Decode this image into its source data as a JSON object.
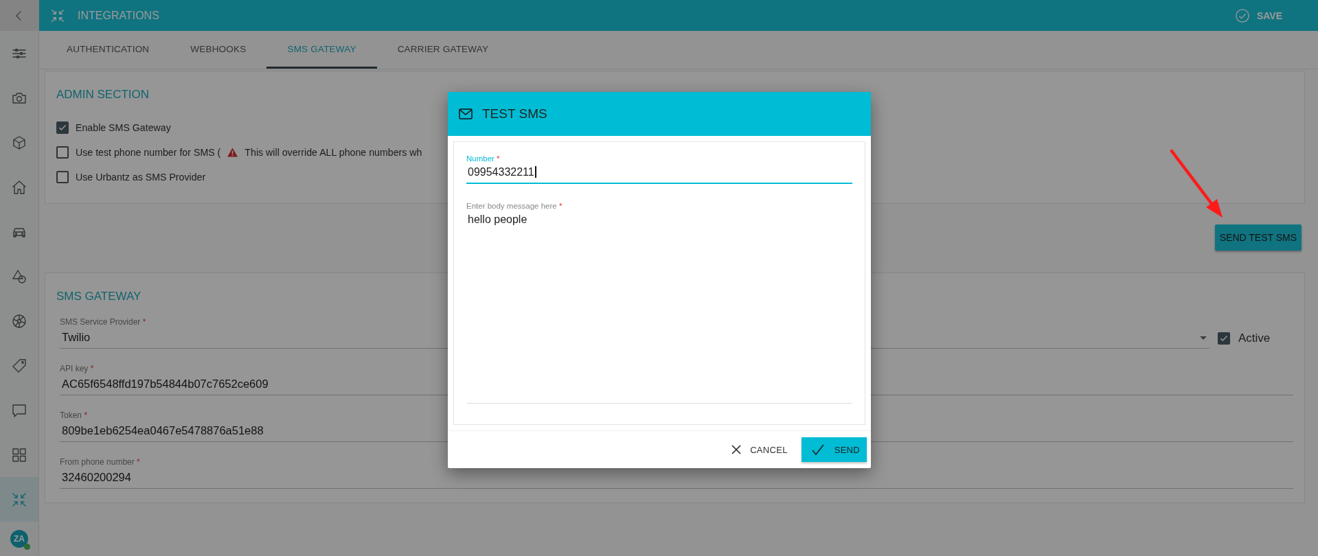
{
  "topbar": {
    "title": "INTEGRATIONS",
    "save": "SAVE"
  },
  "sidebar": {
    "items": [
      {
        "selected": false
      },
      {
        "selected": false
      },
      {
        "selected": false
      },
      {
        "selected": false
      },
      {
        "selected": false
      },
      {
        "selected": false
      },
      {
        "selected": false
      },
      {
        "selected": false
      },
      {
        "selected": false
      },
      {
        "selected": false
      },
      {
        "selected": true
      }
    ],
    "avatar": {
      "initials": "ZA",
      "online": true
    }
  },
  "tabs": [
    {
      "label": "AUTHENTICATION",
      "selected": false
    },
    {
      "label": "WEBHOOKS",
      "selected": false
    },
    {
      "label": "SMS GATEWAY",
      "selected": true
    },
    {
      "label": "CARRIER GATEWAY",
      "selected": false
    }
  ],
  "admin_section": {
    "title": "ADMIN SECTION",
    "checkboxes": [
      {
        "label": "Enable SMS Gateway",
        "checked": true
      },
      {
        "label": "Use test phone number for SMS (",
        "warning": "This will override ALL phone numbers wh",
        "checked": false
      },
      {
        "label": "Use Urbantz as SMS Provider",
        "checked": false
      }
    ]
  },
  "send_test_button": "SEND TEST SMS",
  "sms_gateway": {
    "title": "SMS GATEWAY",
    "fields": [
      {
        "kind": "select",
        "label": "SMS Service Provider",
        "required_mark": "*",
        "value": "Twilio",
        "active": {
          "label": "Active",
          "checked": true
        }
      },
      {
        "kind": "text",
        "label": "API key",
        "required_mark": "*",
        "value": "AC65f6548ffd197b54844b07c7652ce609"
      },
      {
        "kind": "text",
        "label": "Token",
        "required_mark": "*",
        "value": "809be1eb6254ea0467e5478876a51e88"
      },
      {
        "kind": "text",
        "label": "From phone number",
        "required_mark": "*",
        "value": "32460200294"
      }
    ]
  },
  "dialog": {
    "title": "TEST SMS",
    "number": {
      "label": "Number",
      "required_mark": "*",
      "value": "09954332211",
      "focused": true
    },
    "message": {
      "label": "Enter body message here",
      "required_mark": "*",
      "value": "hello people",
      "focused": false
    },
    "cancel": "CANCEL",
    "send": "SEND"
  }
}
